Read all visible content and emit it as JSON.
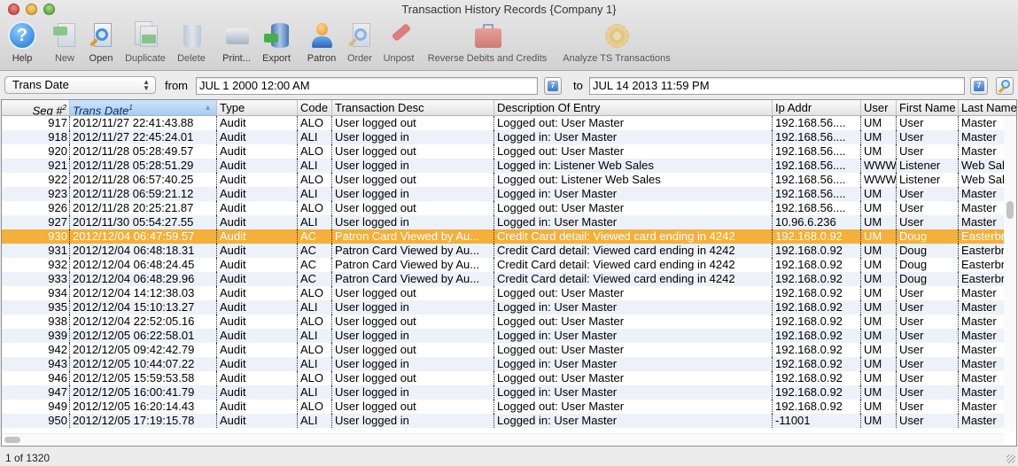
{
  "window": {
    "title": "Transaction History Records {Company 1}"
  },
  "toolbar": {
    "items": [
      {
        "label": "Help",
        "icon": "help-icon",
        "enabled": true
      },
      {
        "label": "New",
        "icon": "new-document-icon",
        "enabled": false
      },
      {
        "label": "Open",
        "icon": "open-document-icon",
        "enabled": true
      },
      {
        "label": "Duplicate",
        "icon": "duplicate-icon",
        "enabled": false
      },
      {
        "label": "Delete",
        "icon": "trash-icon",
        "enabled": false
      },
      {
        "label": "Print...",
        "icon": "printer-icon",
        "enabled": true
      },
      {
        "label": "Export",
        "icon": "export-database-icon",
        "enabled": true
      },
      {
        "label": "Patron",
        "icon": "patron-icon",
        "enabled": true
      },
      {
        "label": "Order",
        "icon": "order-search-icon",
        "enabled": false
      },
      {
        "label": "Unpost",
        "icon": "unpost-wrench-icon",
        "enabled": false
      },
      {
        "label": "Reverse Debits and Credits",
        "icon": "toolbox-icon",
        "enabled": false
      },
      {
        "label": "Analyze TS Transactions",
        "icon": "gear-icon",
        "enabled": false
      }
    ]
  },
  "filter": {
    "field_select": "Trans Date",
    "from_label": "from",
    "from_value": "JUL 1 2000 12:00 AM",
    "to_label": "to",
    "to_value": "JUL 14 2013 11:59 PM",
    "calendar_icon_text": "7"
  },
  "table": {
    "columns": [
      {
        "key": "seq",
        "label": "Seq #",
        "sort_rank": "2"
      },
      {
        "key": "date",
        "label": "Trans Date",
        "sort_rank": "1",
        "sorted": true,
        "sort_dir": "ascending"
      },
      {
        "key": "type",
        "label": "Type"
      },
      {
        "key": "code",
        "label": "Code"
      },
      {
        "key": "tdesc",
        "label": "Transaction Desc"
      },
      {
        "key": "entry",
        "label": "Description Of Entry"
      },
      {
        "key": "ip",
        "label": "Ip Addr"
      },
      {
        "key": "user",
        "label": "User"
      },
      {
        "key": "first",
        "label": "First Name"
      },
      {
        "key": "last",
        "label": "Last Name"
      }
    ],
    "selected_row_index": 8,
    "rows": [
      [
        "917",
        "2012/11/27 22:41:43.88",
        "Audit",
        "ALO",
        "User logged out",
        "Logged out: User Master",
        "192.168.56....",
        "UM",
        "User",
        "Master"
      ],
      [
        "918",
        "2012/11/27 22:45:24.01",
        "Audit",
        "ALI",
        "User logged in",
        "Logged in: User Master",
        "192.168.56....",
        "UM",
        "User",
        "Master"
      ],
      [
        "920",
        "2012/11/28 05:28:49.57",
        "Audit",
        "ALO",
        "User logged out",
        "Logged out: User Master",
        "192.168.56....",
        "UM",
        "User",
        "Master"
      ],
      [
        "921",
        "2012/11/28 05:28:51.29",
        "Audit",
        "ALI",
        "User logged in",
        "Logged in: Listener Web Sales",
        "192.168.56....",
        "WWW",
        "Listener",
        "Web Sal"
      ],
      [
        "922",
        "2012/11/28 06:57:40.25",
        "Audit",
        "ALO",
        "User logged out",
        "Logged out: Listener Web Sales",
        "192.168.56....",
        "WWW",
        "Listener",
        "Web Sal"
      ],
      [
        "923",
        "2012/11/28 06:59:21.12",
        "Audit",
        "ALI",
        "User logged in",
        "Logged in: User Master",
        "192.168.56....",
        "UM",
        "User",
        "Master"
      ],
      [
        "926",
        "2012/11/28 20:25:21.87",
        "Audit",
        "ALO",
        "User logged out",
        "Logged out: User Master",
        "192.168.56....",
        "UM",
        "User",
        "Master"
      ],
      [
        "927",
        "2012/11/30 05:54:27.55",
        "Audit",
        "ALI",
        "User logged in",
        "Logged in: User Master",
        "10.96.6.236",
        "UM",
        "User",
        "Master"
      ],
      [
        "930",
        "2012/12/04 06:47:59.57",
        "Audit",
        "AC",
        "Patron Card Viewed by Au...",
        "Credit Card detail: Viewed card ending in 4242",
        "192.168.0.92",
        "UM",
        "Doug",
        "Easterbr"
      ],
      [
        "931",
        "2012/12/04 06:48:18.31",
        "Audit",
        "AC",
        "Patron Card Viewed by Au...",
        "Credit Card detail: Viewed card ending in 4242",
        "192.168.0.92",
        "UM",
        "Doug",
        "Easterbr"
      ],
      [
        "932",
        "2012/12/04 06:48:24.45",
        "Audit",
        "AC",
        "Patron Card Viewed by Au...",
        "Credit Card detail: Viewed card ending in 4242",
        "192.168.0.92",
        "UM",
        "Doug",
        "Easterbr"
      ],
      [
        "933",
        "2012/12/04 06:48:29.96",
        "Audit",
        "AC",
        "Patron Card Viewed by Au...",
        "Credit Card detail: Viewed card ending in 4242",
        "192.168.0.92",
        "UM",
        "Doug",
        "Easterbr"
      ],
      [
        "934",
        "2012/12/04 14:12:38.03",
        "Audit",
        "ALO",
        "User logged out",
        "Logged out: User Master",
        "192.168.0.92",
        "UM",
        "User",
        "Master"
      ],
      [
        "935",
        "2012/12/04 15:10:13.27",
        "Audit",
        "ALI",
        "User logged in",
        "Logged in: User Master",
        "192.168.0.92",
        "UM",
        "User",
        "Master"
      ],
      [
        "938",
        "2012/12/04 22:52:05.16",
        "Audit",
        "ALO",
        "User logged out",
        "Logged out: User Master",
        "192.168.0.92",
        "UM",
        "User",
        "Master"
      ],
      [
        "939",
        "2012/12/05 06:22:58.01",
        "Audit",
        "ALI",
        "User logged in",
        "Logged in: User Master",
        "192.168.0.92",
        "UM",
        "User",
        "Master"
      ],
      [
        "942",
        "2012/12/05 09:42:42.79",
        "Audit",
        "ALO",
        "User logged out",
        "Logged out: User Master",
        "192.168.0.92",
        "UM",
        "User",
        "Master"
      ],
      [
        "943",
        "2012/12/05 10:44:07.22",
        "Audit",
        "ALI",
        "User logged in",
        "Logged in: User Master",
        "192.168.0.92",
        "UM",
        "User",
        "Master"
      ],
      [
        "946",
        "2012/12/05 15:59:53.58",
        "Audit",
        "ALO",
        "User logged out",
        "Logged out: User Master",
        "192.168.0.92",
        "UM",
        "User",
        "Master"
      ],
      [
        "947",
        "2012/12/05 16:00:41.79",
        "Audit",
        "ALI",
        "User logged in",
        "Logged in: User Master",
        "192.168.0.92",
        "UM",
        "User",
        "Master"
      ],
      [
        "949",
        "2012/12/05 16:20:14.43",
        "Audit",
        "ALO",
        "User logged out",
        "Logged out: User Master",
        "192.168.0.92",
        "UM",
        "User",
        "Master"
      ],
      [
        "950",
        "2012/12/05 17:19:15.78",
        "Audit",
        "ALI",
        "User logged in",
        "Logged in: User Master",
        "-11001",
        "UM",
        "User",
        "Master"
      ]
    ]
  },
  "status": {
    "record_position": "1 of 1320"
  },
  "colors": {
    "selection": "#f4b03a",
    "sorted_header": "#a6ccf2",
    "alt_row": "#edf1fa"
  }
}
